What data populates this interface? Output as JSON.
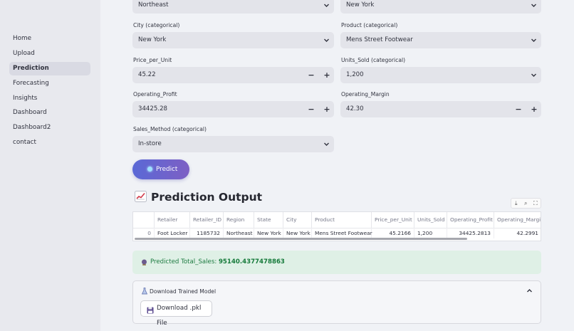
{
  "sidebar": {
    "items": [
      {
        "label": "Home",
        "active": false
      },
      {
        "label": "Upload",
        "active": false
      },
      {
        "label": "Prediction",
        "active": true
      },
      {
        "label": "Forecasting",
        "active": false
      },
      {
        "label": "Insights",
        "active": false
      },
      {
        "label": "Dashboard",
        "active": false
      },
      {
        "label": "Dashboard2",
        "active": false
      },
      {
        "label": "contact",
        "active": false
      }
    ]
  },
  "form": {
    "region_value": "Northeast",
    "state_value": "New York",
    "city": {
      "label": "City (categorical)",
      "value": "New York"
    },
    "product": {
      "label": "Product (categorical)",
      "value": "Mens Street Footwear"
    },
    "price": {
      "label": "Price_per_Unit",
      "value": "45.22"
    },
    "units": {
      "label": "Units_Sold (categorical)",
      "value": "1,200"
    },
    "op_profit": {
      "label": "Operating_Profit",
      "value": "34425.28"
    },
    "op_margin": {
      "label": "Operating_Margin",
      "value": "42.30"
    },
    "sales_method": {
      "label": "Sales_Method (categorical)",
      "value": "In-store"
    },
    "minus": "−",
    "plus": "+",
    "predict_label": "Predict"
  },
  "output": {
    "heading": "Prediction Output",
    "icon": "chart-increasing-icon",
    "table": {
      "columns": [
        "",
        "Retailer",
        "Retailer_ID",
        "Region",
        "State",
        "City",
        "Product",
        "Price_per_Unit",
        "Units_Sold",
        "Operating_Profit",
        "Operating_Margin"
      ],
      "row": [
        "0",
        "Foot Locker",
        "1185732",
        "Northeast",
        "New York",
        "New York",
        "Mens Street Footwear",
        "45.2166",
        "1,200",
        "34425.2813",
        "42.2991"
      ]
    },
    "result_label": "Predicted Total_Sales:",
    "result_value": "95140.4377478863"
  },
  "download": {
    "title": "Download Trained Model",
    "button_label": "Download .pkl File"
  },
  "colors": {
    "accent_start": "#5a69d6",
    "accent_end": "#7d5fc4",
    "success_bg": "#dff0e6",
    "success_text": "#1b7a3f"
  }
}
